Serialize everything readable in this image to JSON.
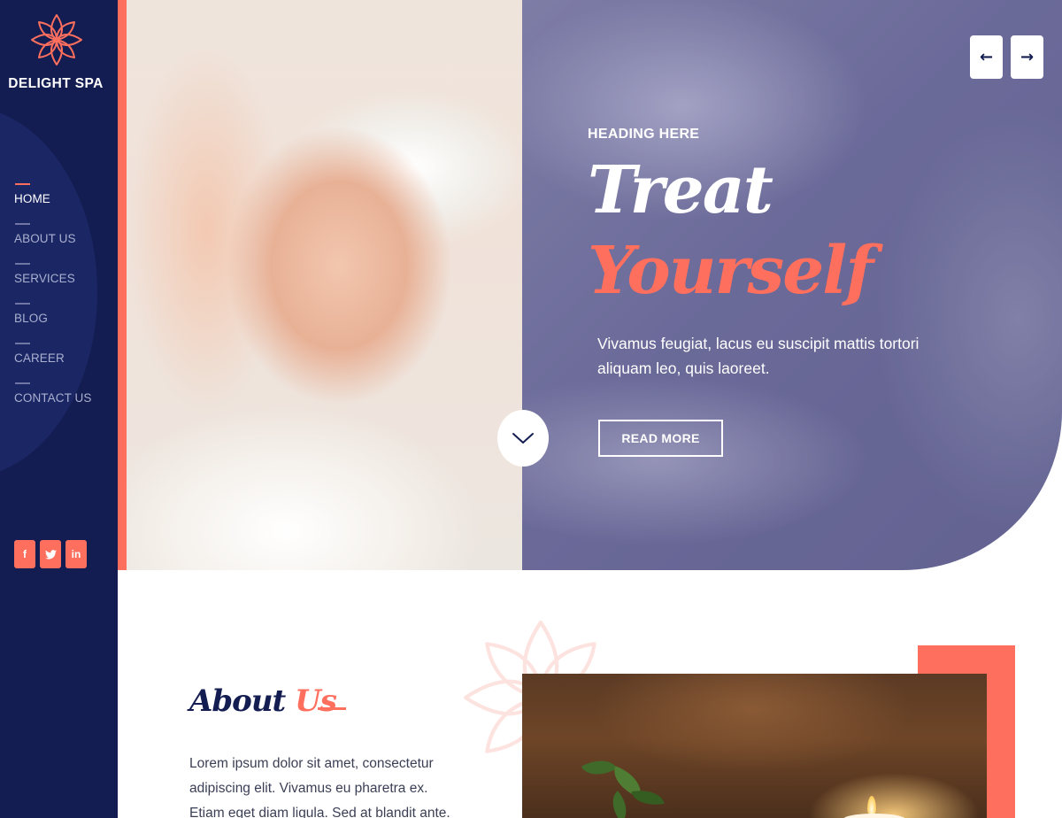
{
  "brand": {
    "name": "DELIGHT SPA",
    "logo_icon": "lotus-icon"
  },
  "colors": {
    "navy": "#141d52",
    "coral": "#ff6f5e",
    "white": "#ffffff"
  },
  "nav": [
    {
      "label": "HOME",
      "active": true
    },
    {
      "label": "ABOUT US",
      "active": false
    },
    {
      "label": "SERVICES",
      "active": false
    },
    {
      "label": "BLOG",
      "active": false
    },
    {
      "label": "CAREER",
      "active": false
    },
    {
      "label": "CONTACT US",
      "active": false
    }
  ],
  "socials": [
    {
      "icon": "facebook-icon",
      "glyph": "f"
    },
    {
      "icon": "twitter-icon",
      "glyph": "t"
    },
    {
      "icon": "linkedin-icon",
      "glyph": "in"
    }
  ],
  "hero": {
    "eyebrow": "HEADING HERE",
    "title_line1": "Treat",
    "title_line2": "Yourself",
    "text": "Vivamus feugiat, lacus eu suscipit mattis tortori aliquam leo, quis laoreet.",
    "button": "READ MORE",
    "prev_glyph": "←",
    "next_glyph": "→",
    "scroll_icon": "chevron-down-icon"
  },
  "about": {
    "title_part1": "About",
    "title_part2": "Us",
    "text": "Lorem ipsum dolor sit amet, consectetur adipiscing elit. Vivamus eu pharetra ex. Etiam eget diam ligula. Sed at blandit ante."
  }
}
